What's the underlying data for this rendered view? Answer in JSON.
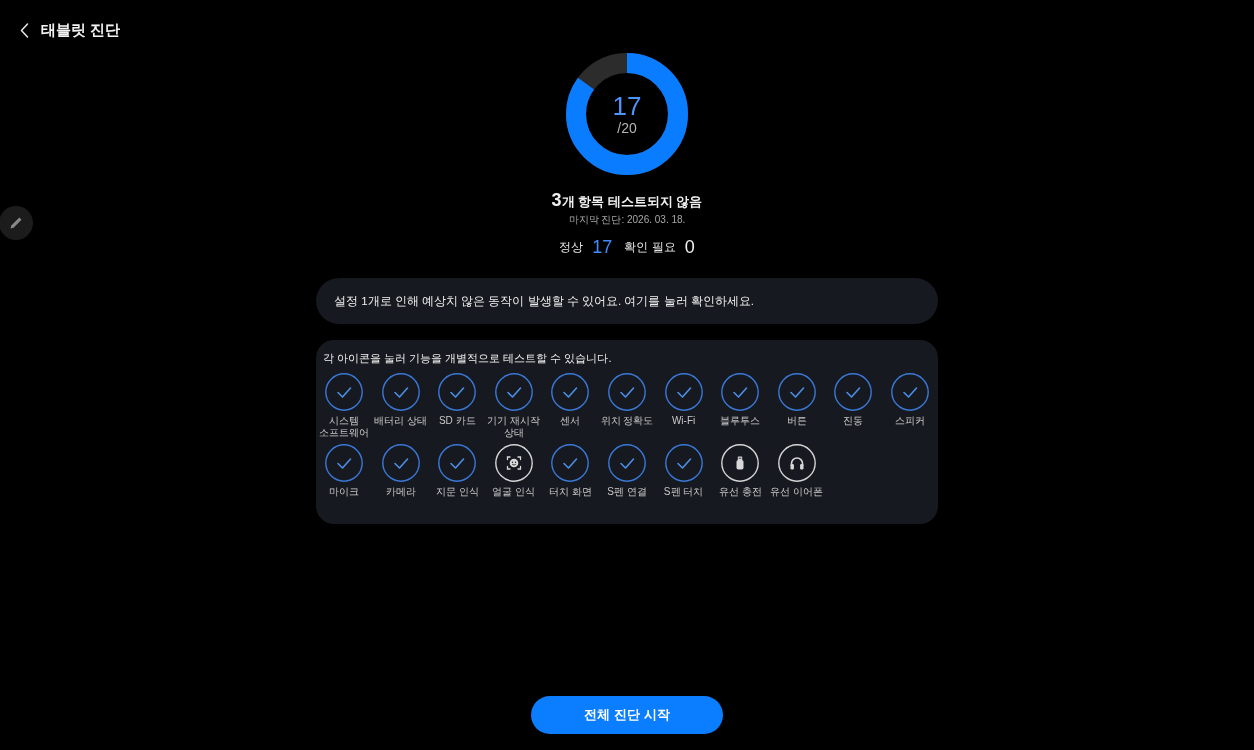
{
  "header": {
    "title": "태블릿 진단"
  },
  "score": {
    "passed": "17",
    "total": "/20",
    "level": 0.85
  },
  "summary": {
    "count": "3",
    "text": "개 항목 테스트되지 않음",
    "last_diagnosis": "마지막 진단: 2026. 03. 18."
  },
  "stats": [
    {
      "label": "정상",
      "value": "17",
      "kind": "normal"
    },
    {
      "label": "확인 필요",
      "value": "0",
      "kind": "attention"
    }
  ],
  "notice": {
    "text": "설정 1개로 인해 예상치 않은 동작이 발생할 수 있어요. 여기를 눌러 확인하세요."
  },
  "tests": {
    "instruction": "각 아이콘을 눌러 기능을 개별적으로 테스트할 수 있습니다.",
    "items": [
      {
        "label": "시스템 소프트웨어",
        "tested": true,
        "kind": "check"
      },
      {
        "label": "배터리 상태",
        "tested": true,
        "kind": "check"
      },
      {
        "label": "SD 카드",
        "tested": true,
        "kind": "check"
      },
      {
        "label": "기기 재시작 상태",
        "tested": true,
        "kind": "check"
      },
      {
        "label": "센서",
        "tested": true,
        "kind": "check"
      },
      {
        "label": "위치 정확도",
        "tested": true,
        "kind": "check"
      },
      {
        "label": "Wi-Fi",
        "tested": true,
        "kind": "check"
      },
      {
        "label": "블루투스",
        "tested": true,
        "kind": "check"
      },
      {
        "label": "버튼",
        "tested": true,
        "kind": "check"
      },
      {
        "label": "진동",
        "tested": true,
        "kind": "check"
      },
      {
        "label": "스피커",
        "tested": true,
        "kind": "check"
      },
      {
        "label": "마이크",
        "tested": true,
        "kind": "check"
      },
      {
        "label": "카메라",
        "tested": true,
        "kind": "check"
      },
      {
        "label": "지문 인식",
        "tested": true,
        "kind": "check"
      },
      {
        "label": "얼굴 인식",
        "tested": false,
        "kind": "face"
      },
      {
        "label": "터치 화면",
        "tested": true,
        "kind": "check"
      },
      {
        "label": "S펜 연결",
        "tested": true,
        "kind": "check"
      },
      {
        "label": "S펜 터치",
        "tested": true,
        "kind": "check"
      },
      {
        "label": "유선 충전",
        "tested": false,
        "kind": "charger"
      },
      {
        "label": "유선 이어폰",
        "tested": false,
        "kind": "headphones"
      }
    ]
  },
  "start_button": {
    "label": "전체 진단 시작"
  }
}
